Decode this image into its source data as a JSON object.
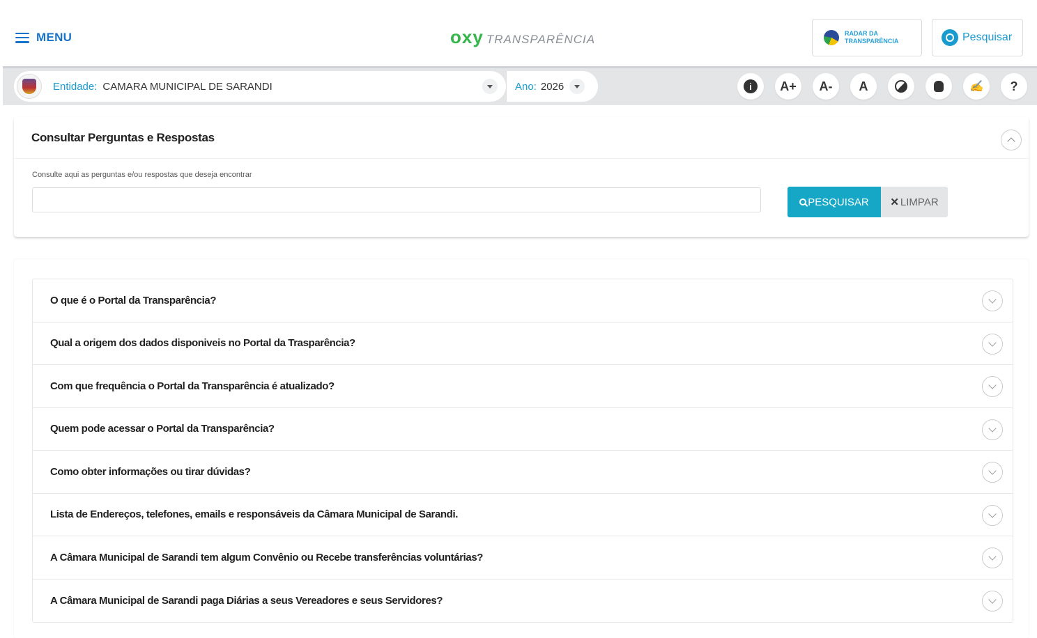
{
  "header": {
    "menu_label": "MENU",
    "logo_brand": "oxy",
    "logo_product": "TRANSPARÊNCIA",
    "radar_label": "RADAR DA TRANSPARÊNCIA",
    "search_label": "Pesquisar"
  },
  "entity_bar": {
    "entity_label": "Entidade:",
    "entity_value": "CAMARA MUNICIPAL DE SARANDI",
    "year_label": "Ano:",
    "year_value": "2026",
    "accessibility": [
      "A+",
      "A-",
      "A",
      "?"
    ]
  },
  "search_card": {
    "title": "Consultar Perguntas e Respostas",
    "hint": "Consulte aqui as perguntas e/ou respostas que deseja encontrar",
    "input_value": "",
    "search_button": "PESQUISAR",
    "clear_button": "LIMPAR"
  },
  "faq": [
    "O que é o Portal da Transparência?",
    "Qual a origem dos dados disponiveis no Portal da Trasparência?",
    "Com que frequência o Portal da Transparência é atualizado?",
    "Quem pode acessar o Portal da Transparência?",
    "Como obter informações ou tirar dúvidas?",
    "Lista de Endereços, telefones, emails e responsáveis da Câmara Municipal de Sarandi.",
    "A Câmara Municipal de Sarandi tem algum Convênio ou Recebe transferências voluntárias?",
    "A Câmara Municipal de Sarandi paga Diárias a seus Vereadores e seus Servidores?"
  ],
  "colors": {
    "accent_blue": "#1a9bd0",
    "logo_green": "#35b54a",
    "button_teal": "#16a6c6"
  }
}
